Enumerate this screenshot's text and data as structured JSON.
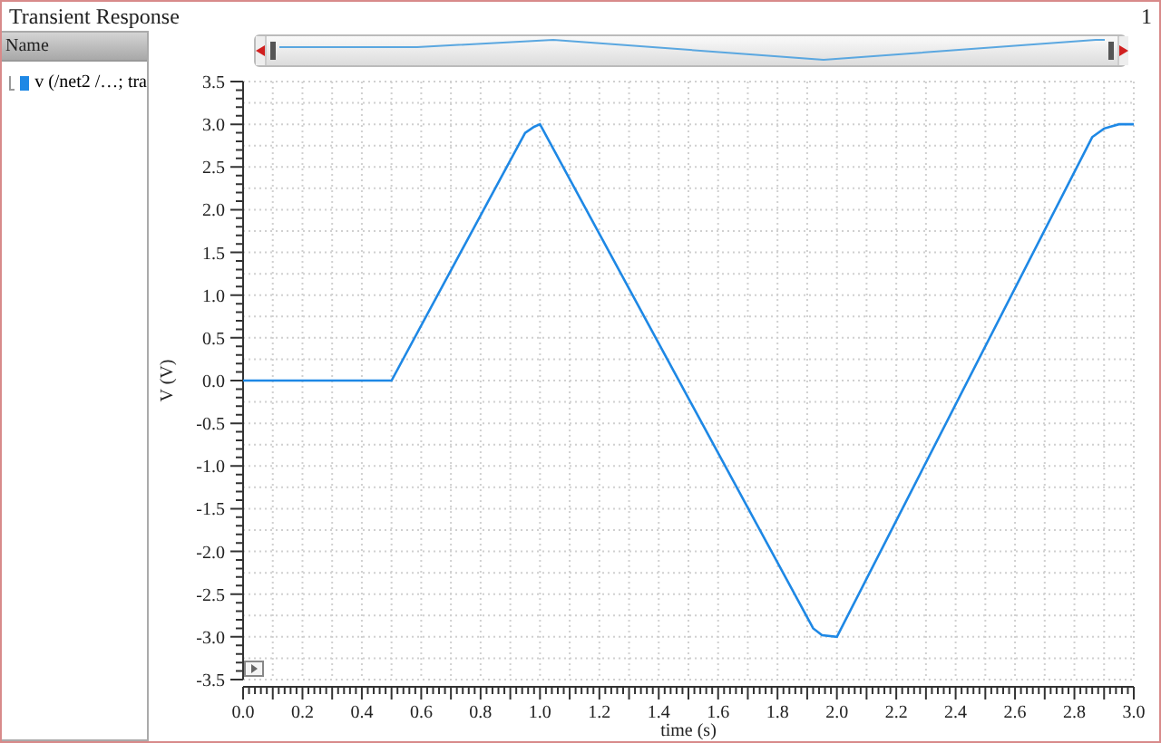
{
  "window": {
    "title": "Transient Response",
    "index": "1"
  },
  "sidebar": {
    "header": "Name"
  },
  "chart_data": {
    "type": "line",
    "xlabel": "time (s)",
    "ylabel": "V (V)",
    "grid": true,
    "xlim": [
      0,
      3
    ],
    "ylim": [
      -3.5,
      3.5
    ],
    "x": [
      0,
      0.5,
      0.95,
      0.98,
      1.0,
      1.92,
      1.95,
      2.0,
      2.86,
      2.9,
      2.95,
      3.0
    ],
    "series": [
      {
        "name": "v (/net2 /…; tra",
        "color": "#1e88e5",
        "values": [
          0,
          0,
          2.9,
          2.97,
          3.0,
          -2.9,
          -2.98,
          -3.0,
          2.85,
          2.95,
          3.0,
          3.0
        ]
      }
    ],
    "xticks": [
      {
        "value": 0,
        "label": "0.0"
      },
      {
        "value": 0.2,
        "label": "0.2"
      },
      {
        "value": 0.4,
        "label": "0.4"
      },
      {
        "value": 0.6,
        "label": "0.6"
      },
      {
        "value": 0.8,
        "label": "0.8"
      },
      {
        "value": 1,
        "label": "1.0"
      },
      {
        "value": 1.2,
        "label": "1.2"
      },
      {
        "value": 1.4,
        "label": "1.4"
      },
      {
        "value": 1.6,
        "label": "1.6"
      },
      {
        "value": 1.8,
        "label": "1.8"
      },
      {
        "value": 2,
        "label": "2.0"
      },
      {
        "value": 2.2,
        "label": "2.2"
      },
      {
        "value": 2.4,
        "label": "2.4"
      },
      {
        "value": 2.6,
        "label": "2.6"
      },
      {
        "value": 2.8,
        "label": "2.8"
      },
      {
        "value": 3,
        "label": "3.0"
      }
    ],
    "yticks": [
      {
        "value": 3.5,
        "label": "3.5"
      },
      {
        "value": 3,
        "label": "3.0"
      },
      {
        "value": 2.5,
        "label": "2.5"
      },
      {
        "value": 2,
        "label": "2.0"
      },
      {
        "value": 1.5,
        "label": "1.5"
      },
      {
        "value": 1,
        "label": "1.0"
      },
      {
        "value": 0.5,
        "label": "0.5"
      },
      {
        "value": 0,
        "label": "0.0"
      },
      {
        "value": -0.5,
        "label": "-0.5"
      },
      {
        "value": -1,
        "label": "-1.0"
      },
      {
        "value": -1.5,
        "label": "-1.5"
      },
      {
        "value": -2,
        "label": "-2.0"
      },
      {
        "value": -2.5,
        "label": "-2.5"
      },
      {
        "value": -3,
        "label": "-3.0"
      },
      {
        "value": -3.5,
        "label": "-3.5"
      }
    ]
  }
}
